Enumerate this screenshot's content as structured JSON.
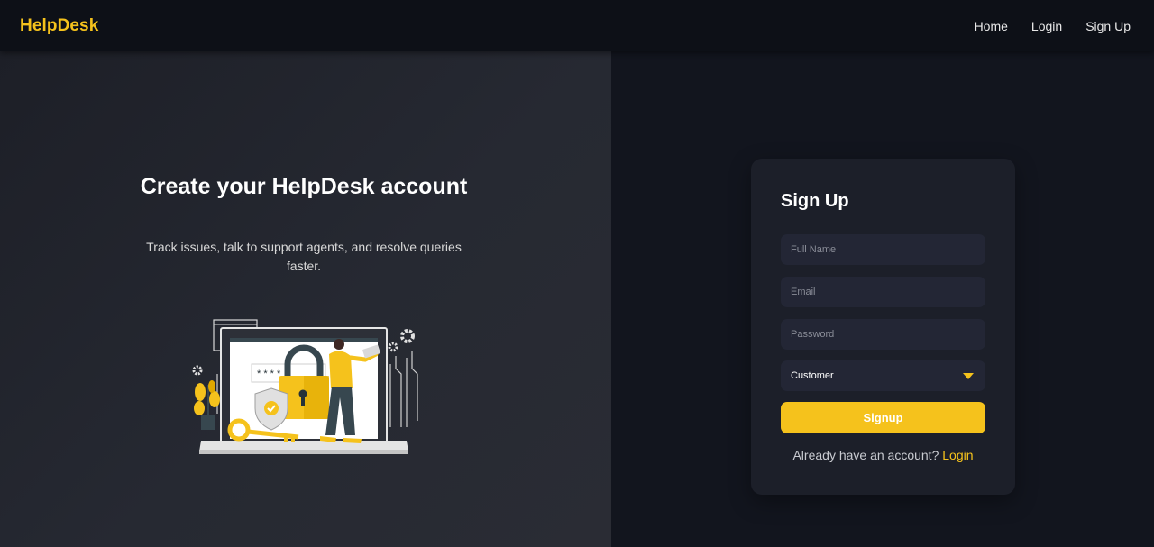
{
  "navbar": {
    "brand": "HelpDesk",
    "links": [
      "Home",
      "Login",
      "Sign Up"
    ]
  },
  "hero": {
    "title": "Create your HelpDesk account",
    "subtitle": "Track issues, talk to support agents, and resolve queries faster.",
    "password_mask": "* * * *"
  },
  "form": {
    "title": "Sign Up",
    "full_name_placeholder": "Full Name",
    "email_placeholder": "Email",
    "password_placeholder": "Password",
    "role_selected": "Customer",
    "submit_label": "Signup",
    "login_prompt": "Already have an account?",
    "login_link": "Login"
  },
  "colors": {
    "accent": "#f5c21c",
    "background": "#12151e",
    "card": "#1c1f29",
    "input": "#232635"
  },
  "icons": [
    "caret-down-icon",
    "padlock-icon",
    "shield-check-icon",
    "key-icon",
    "gear-icon",
    "plant-icon"
  ]
}
